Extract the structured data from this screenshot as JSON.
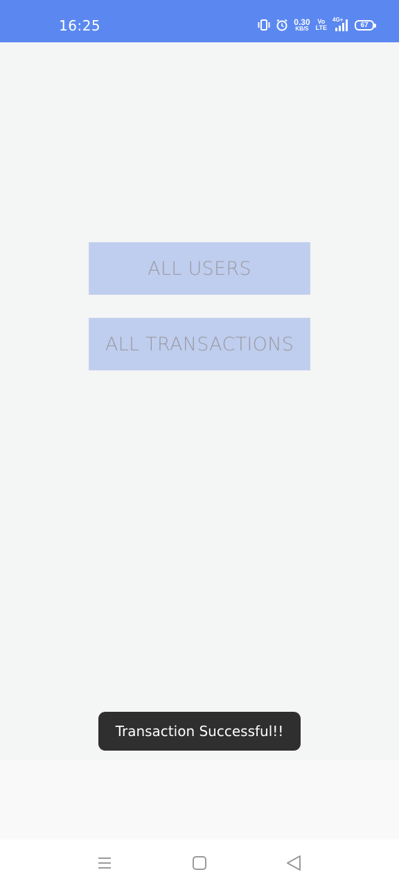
{
  "status_bar": {
    "time": "16:25",
    "net_speed_value": "0.30",
    "net_speed_unit": "KB/S",
    "volte_top": "Vo",
    "volte_bottom": "LTE",
    "network_type": "4G+",
    "battery_level": "67",
    "icons": [
      "vibrate-icon",
      "alarm-icon",
      "signal-icon",
      "battery-icon"
    ]
  },
  "main": {
    "buttons": [
      {
        "label": "ALL USERS"
      },
      {
        "label": "ALL TRANSACTIONS"
      }
    ]
  },
  "toast": {
    "message": "Transaction Successful!!"
  },
  "nav_bar": {
    "icons": [
      "menu-icon",
      "home-icon",
      "back-icon"
    ]
  },
  "colors": {
    "status_bar": "#5b88f0",
    "button_bg": "#bfcdee",
    "button_text": "#9a9aa0",
    "toast_bg": "#2f2f2f",
    "background": "#f4f5f5"
  }
}
